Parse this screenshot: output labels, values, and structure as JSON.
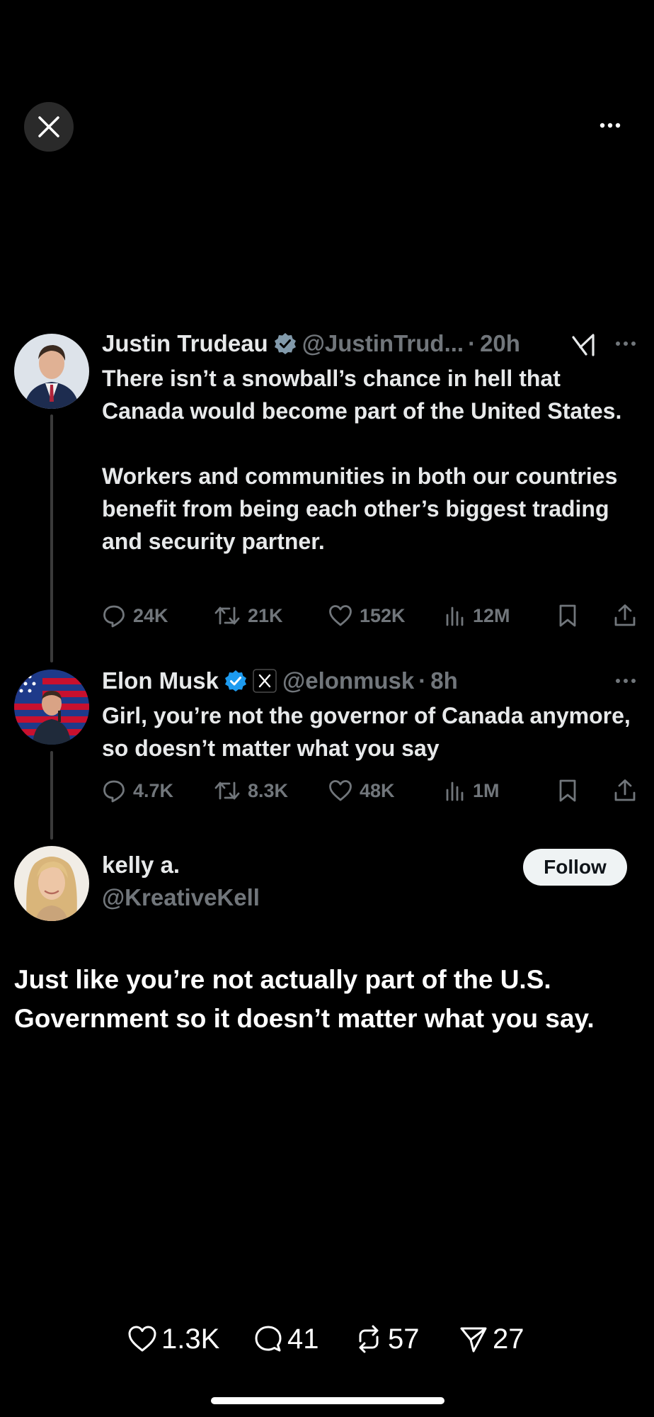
{
  "tweets": [
    {
      "name": "Justin Trudeau",
      "handle": "@JustinTrud...",
      "time": "20h",
      "text": "There isn’t a snowball’s chance in hell that Canada would become part of the United States.\n\nWorkers and communities in both our countries benefit from being each other’s biggest trading and security partner.",
      "replies": "24K",
      "reposts": "21K",
      "likes": "152K",
      "views": "12M"
    },
    {
      "name": "Elon Musk",
      "handle": "@elonmusk",
      "time": "8h",
      "text": "Girl, you’re not the governor of Canada anymore, so doesn’t matter what you say",
      "replies": "4.7K",
      "reposts": "8.3K",
      "likes": "48K",
      "views": "1M"
    }
  ],
  "reply": {
    "name": "kelly a.",
    "handle": "@KreativeKell",
    "follow_label": "Follow",
    "text": "Just like you’re not actually part of the U.S. Government so it doesn’t matter what you say."
  },
  "bottom_stats": {
    "likes": "1.3K",
    "comments": "41",
    "reposts": "57",
    "shares": "27"
  },
  "colors": {
    "background": "#000000",
    "secondary_text": "#71767b",
    "verified_blue": "#1d9bf0",
    "thread_line": "#3a3a3a"
  },
  "icons": [
    "close-icon",
    "more-icon",
    "verified-badge-icon",
    "grok-icon",
    "x-logo-badge-icon",
    "reply-icon",
    "repost-icon",
    "like-icon",
    "views-icon",
    "bookmark-icon",
    "share-icon",
    "heart-icon",
    "comment-icon",
    "send-icon"
  ]
}
